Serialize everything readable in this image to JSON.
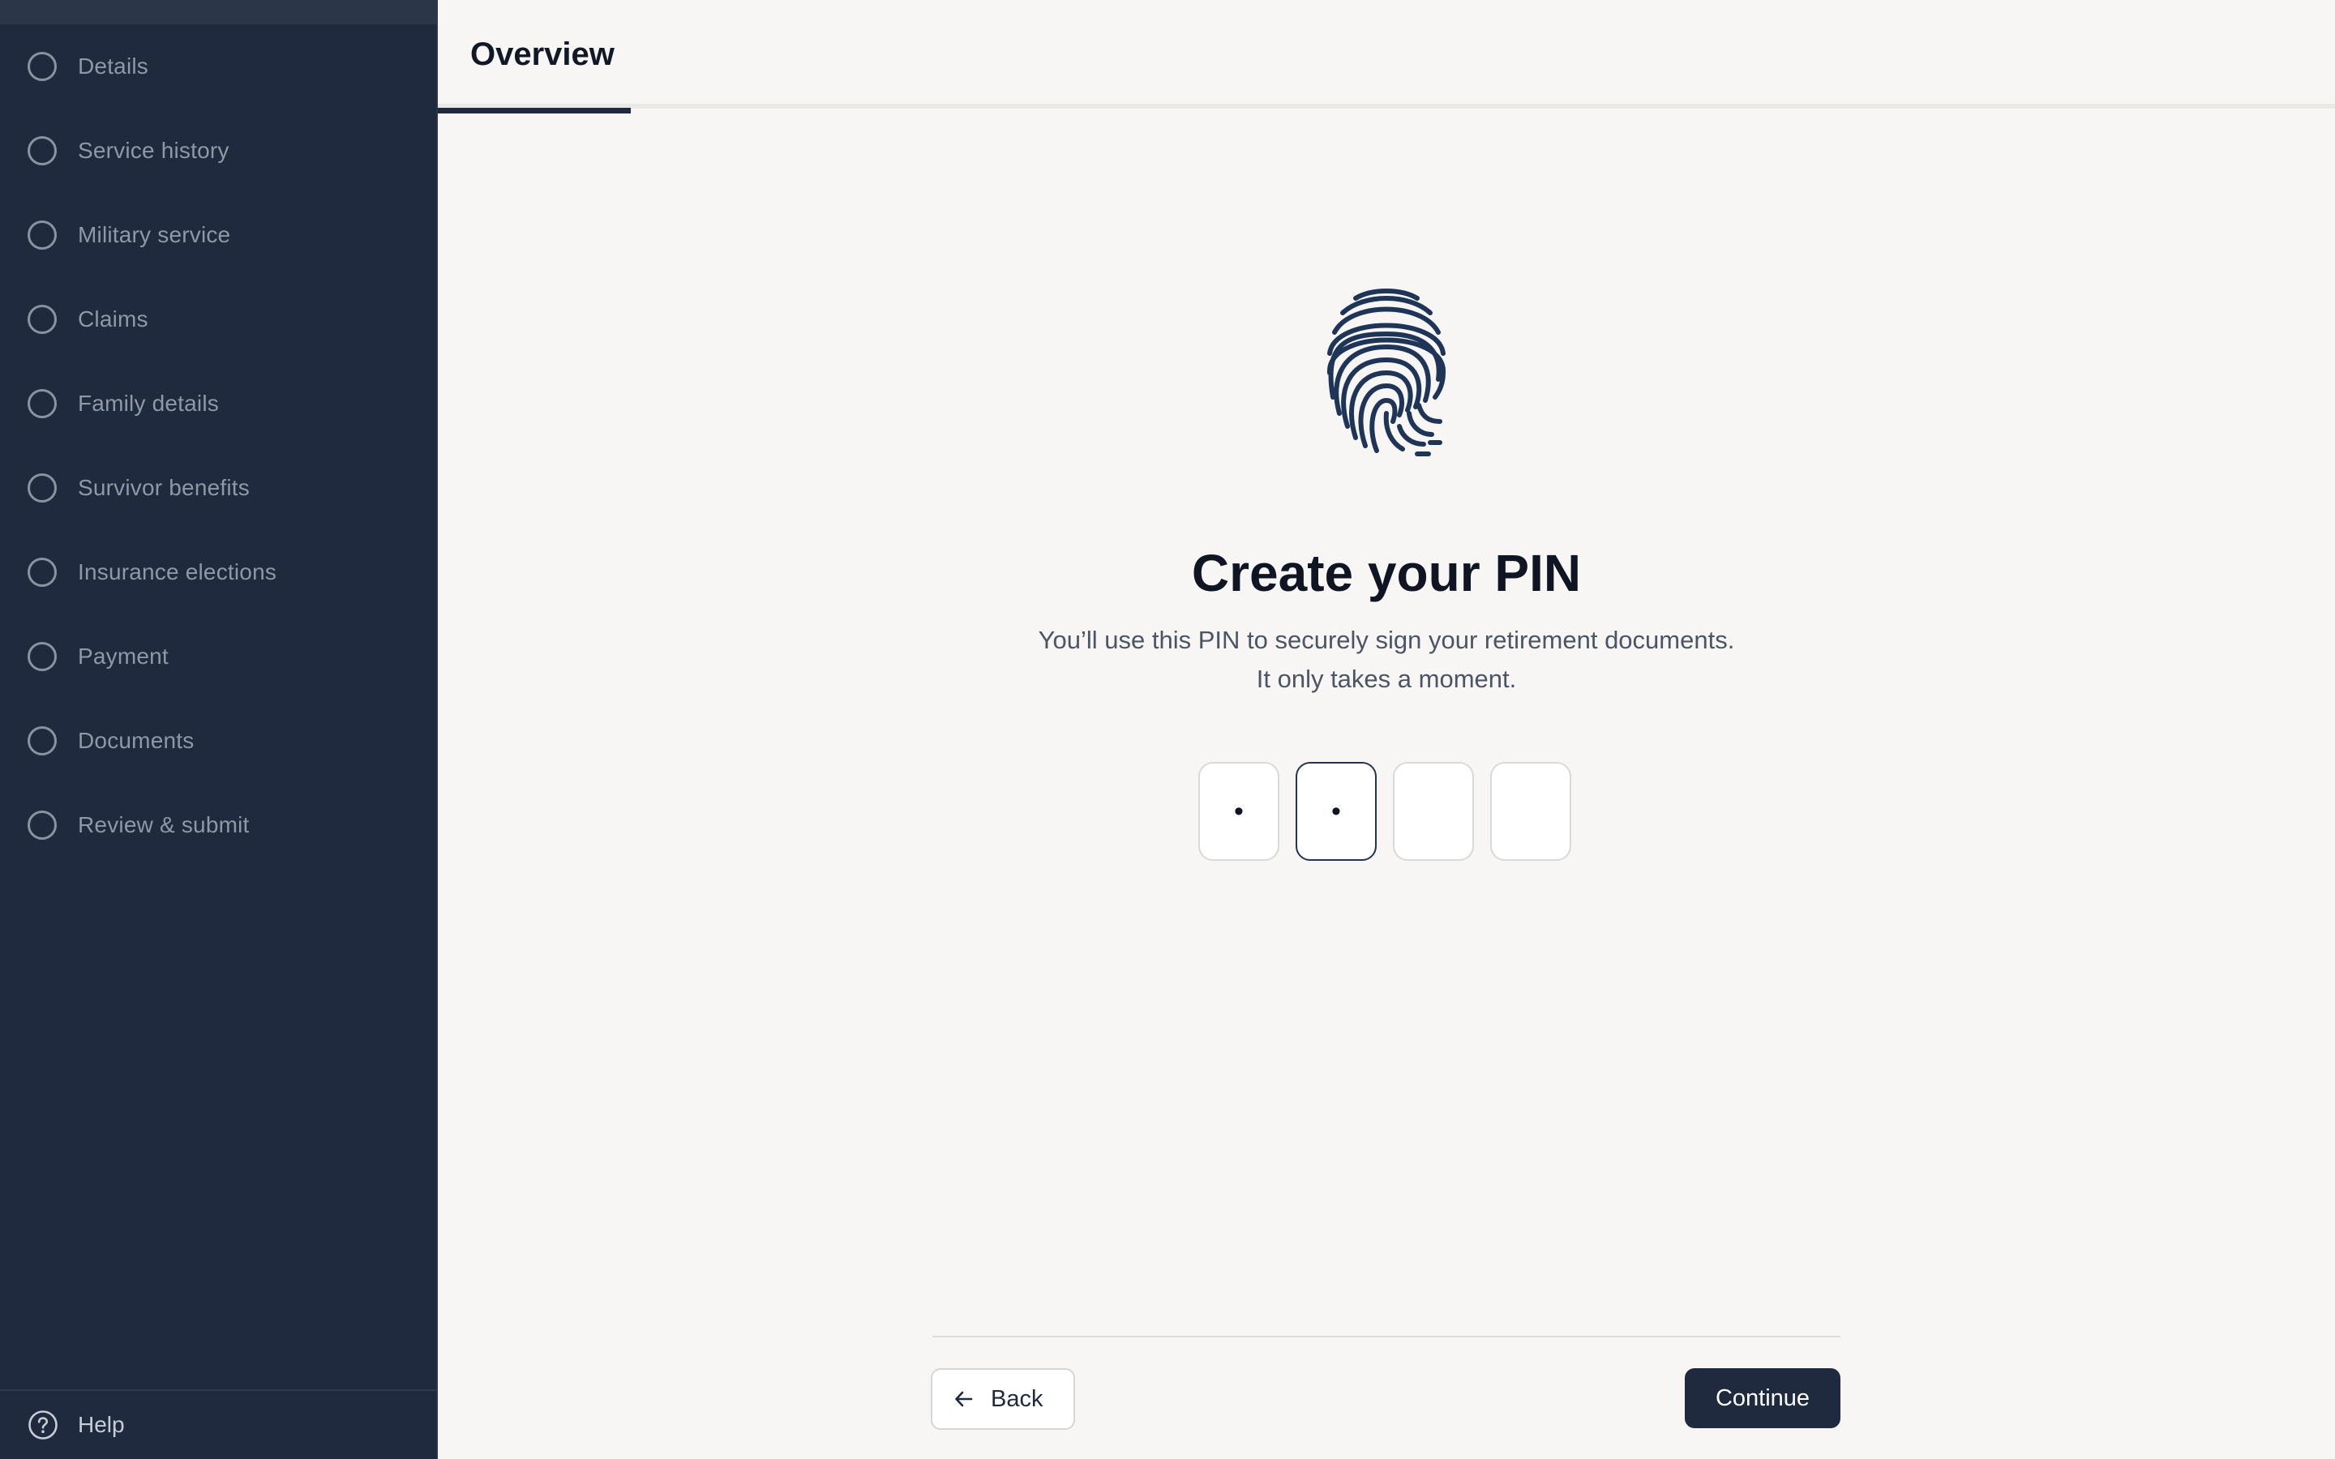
{
  "sidebar": {
    "items": [
      {
        "label": "Details",
        "icon": "step-circle-icon"
      },
      {
        "label": "Service history",
        "icon": "step-circle-icon"
      },
      {
        "label": "Military service",
        "icon": "step-circle-icon"
      },
      {
        "label": "Claims",
        "icon": "step-circle-icon"
      },
      {
        "label": "Family details",
        "icon": "step-circle-icon"
      },
      {
        "label": "Survivor benefits",
        "icon": "step-circle-icon"
      },
      {
        "label": "Insurance elections",
        "icon": "step-circle-icon"
      },
      {
        "label": "Payment",
        "icon": "step-circle-icon"
      },
      {
        "label": "Documents",
        "icon": "step-circle-icon"
      },
      {
        "label": "Review & submit",
        "icon": "step-circle-icon"
      }
    ],
    "help_label": "Help",
    "help_icon": "question-circle-icon"
  },
  "tabs": {
    "active_label": "Overview"
  },
  "main": {
    "illustration": "fingerprint-icon",
    "title": "Create your PIN",
    "subtitle_line1": "You’ll use this PIN to securely sign your retirement documents.",
    "subtitle_line2": "It only takes a moment.",
    "pin": {
      "digits": [
        "•",
        "•",
        "",
        ""
      ],
      "focused_index": 1
    }
  },
  "footer": {
    "back_label": "Back",
    "back_icon": "arrow-left-icon",
    "continue_label": "Continue"
  },
  "colors": {
    "sidebar_bg": "#1f2a3e",
    "page_bg": "#f7f6f4",
    "primary": "#1f2a3e",
    "muted_text": "#8f98a8"
  }
}
